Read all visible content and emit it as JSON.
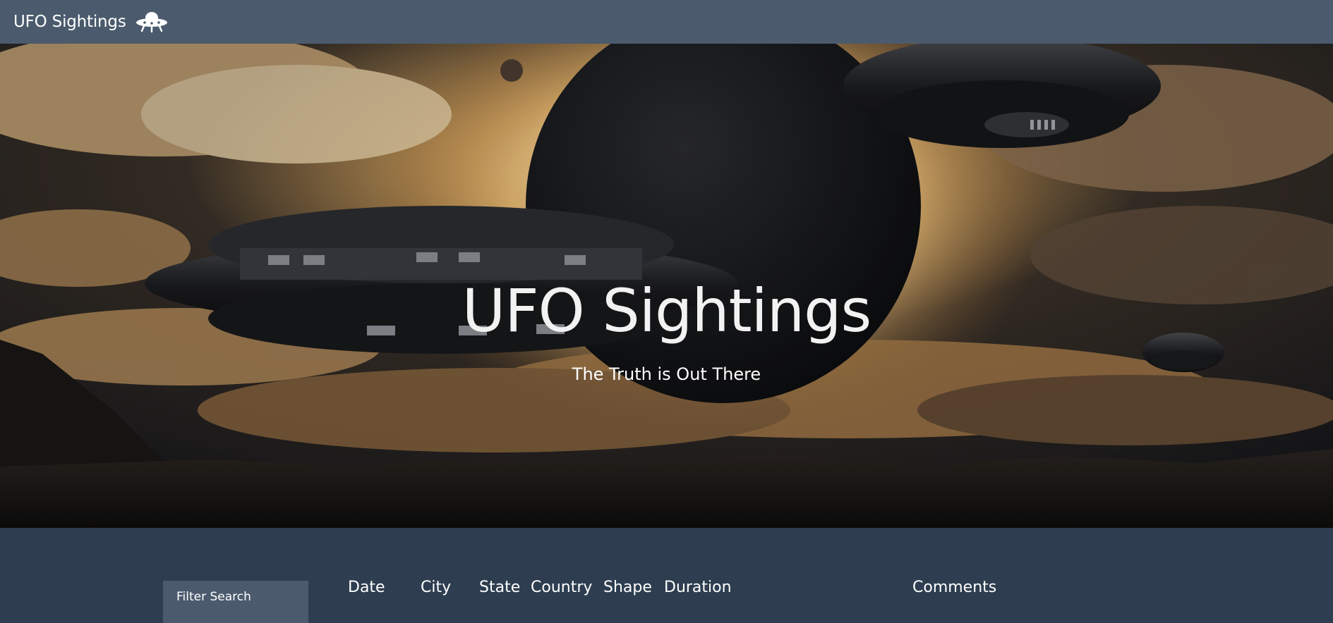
{
  "navbar": {
    "brand_text": "UFO Sightings",
    "brand_icon": "ufo-icon"
  },
  "hero": {
    "title": "UFO Sightings",
    "subtitle": "The Truth is Out There"
  },
  "filter": {
    "title": "Filter Search"
  },
  "table": {
    "headers": [
      "Date",
      "City",
      "State",
      "Country",
      "Shape",
      "Duration",
      "Comments"
    ]
  },
  "colors": {
    "navbar": "#4b5b6d",
    "page_background": "#2e3e50",
    "filter_panel": "#4b5b6d"
  }
}
